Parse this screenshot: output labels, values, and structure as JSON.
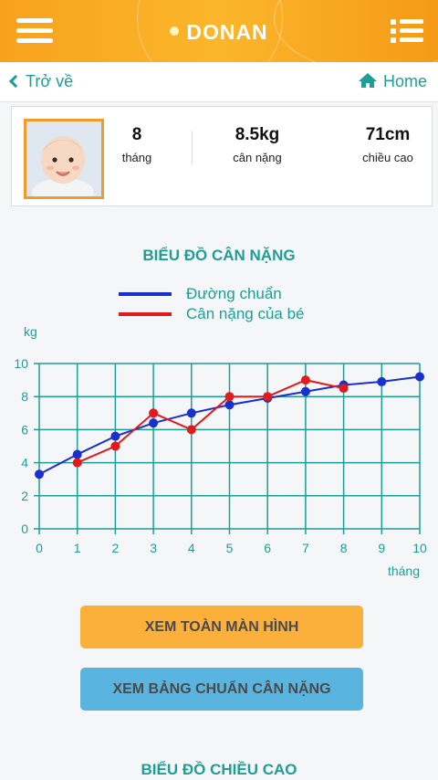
{
  "header": {
    "title": "DONAN"
  },
  "nav": {
    "back_label": "Trở về",
    "home_label": "Home"
  },
  "profile": {
    "age_value": "8",
    "age_label": "tháng",
    "weight_value": "8.5kg",
    "weight_label": "cân nặng",
    "height_value": "71cm",
    "height_label": "chiều cao"
  },
  "weight_chart_title": "BIỂU ĐỒ CÂN NẶNG",
  "legend": {
    "standard": "Đường chuẩn",
    "baby": "Cân nặng của bé"
  },
  "chart_data": {
    "type": "line",
    "ylabel": "kg",
    "xlabel": "tháng",
    "xlim": [
      0,
      10
    ],
    "ylim": [
      0,
      10
    ],
    "x_ticks": [
      0,
      1,
      2,
      3,
      4,
      5,
      6,
      7,
      8,
      9,
      10
    ],
    "y_ticks": [
      0,
      2,
      4,
      6,
      8,
      10
    ],
    "grid": true,
    "series": [
      {
        "name": "Đường chuẩn",
        "color": "#1a2fd0",
        "x": [
          0,
          1,
          2,
          3,
          4,
          5,
          6,
          7,
          8,
          9,
          10
        ],
        "y": [
          3.3,
          4.5,
          5.6,
          6.4,
          7.0,
          7.5,
          7.9,
          8.3,
          8.7,
          8.9,
          9.2
        ]
      },
      {
        "name": "Cân nặng của bé",
        "color": "#e01b1b",
        "x": [
          1,
          2,
          3,
          4,
          5,
          6,
          7,
          8
        ],
        "y": [
          4.0,
          5.0,
          7.0,
          6.0,
          8.0,
          8.0,
          9.0,
          8.5
        ]
      }
    ]
  },
  "buttons": {
    "fullscreen": "XEM TOÀN MÀN HÌNH",
    "standard_table": "XEM BẢNG CHUẨN CÂN NẶNG"
  },
  "height_chart_title": "BIỂU ĐỒ CHIỀU CAO",
  "colors": {
    "accent": "#1e9e94",
    "header": "#f7a21d",
    "grid": "#1e9e94"
  }
}
